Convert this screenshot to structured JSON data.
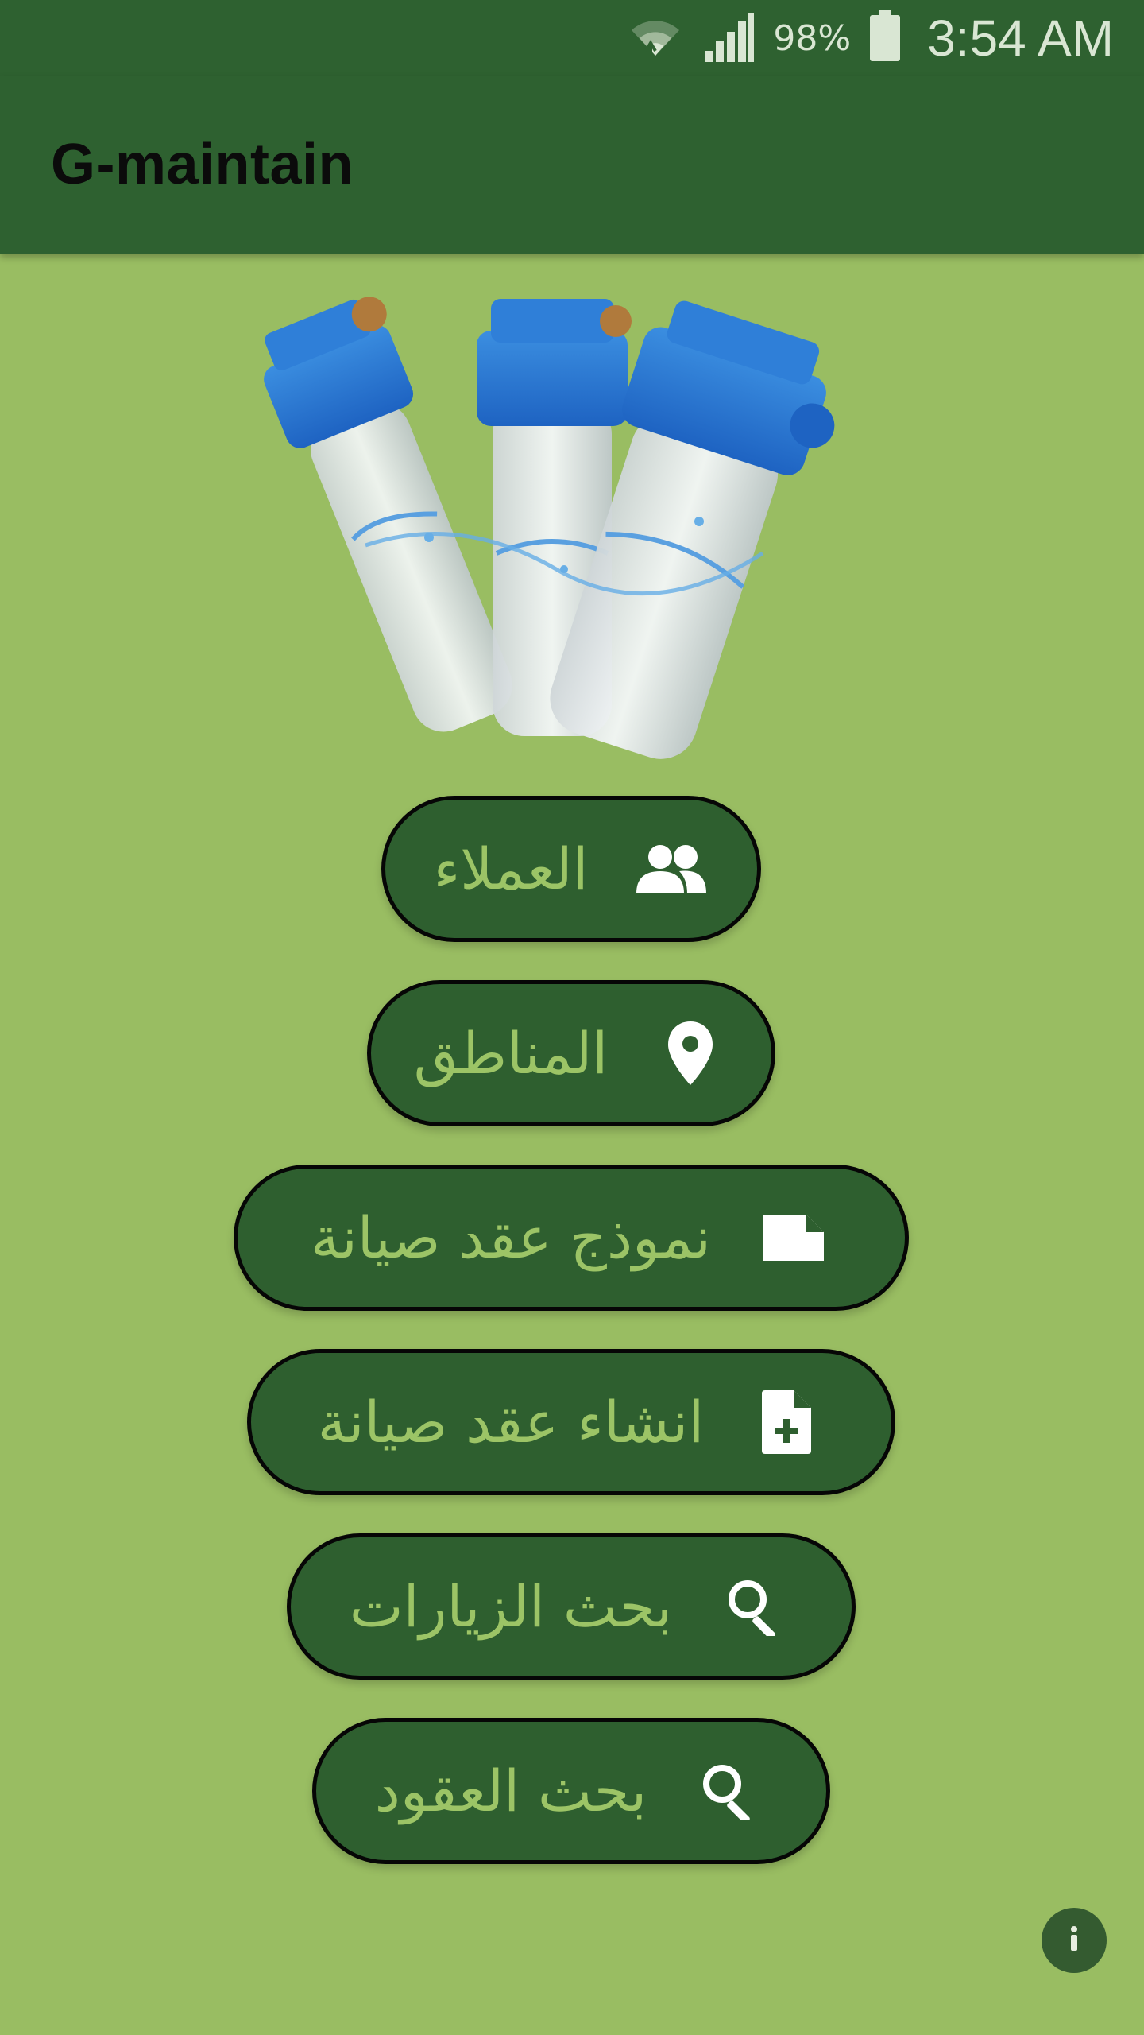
{
  "status_bar": {
    "battery_percent": "98%",
    "time": "3:54 AM",
    "icons": [
      "wifi-icon",
      "signal-icon",
      "battery-icon"
    ]
  },
  "app_bar": {
    "title": "G-maintain"
  },
  "hero": {
    "image": "water-filter-housings-illustration"
  },
  "menu": {
    "customers": {
      "label": "العملاء",
      "icon": "people-icon"
    },
    "areas": {
      "label": "المناطق",
      "icon": "location-pin-icon"
    },
    "contract_template": {
      "label": "نموذج عقد صيانة",
      "icon": "note-icon"
    },
    "create_contract": {
      "label": "انشاء عقد صيانة",
      "icon": "add-document-icon"
    },
    "search_visits": {
      "label": "بحث الزيارات",
      "icon": "search-icon"
    },
    "search_contracts": {
      "label": "بحث العقود",
      "icon": "search-icon"
    }
  },
  "colors": {
    "background": "#99bd62",
    "bar": "#2e6130",
    "button": "#2e5f2f",
    "button_text": "#9cc466"
  }
}
